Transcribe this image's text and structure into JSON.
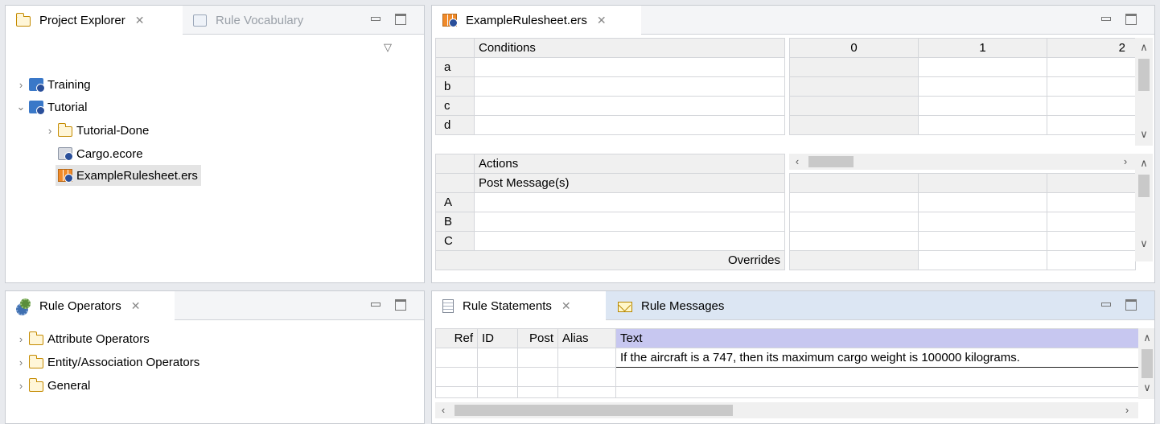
{
  "project_explorer": {
    "tabs": [
      {
        "label": "Project Explorer",
        "active": true
      },
      {
        "label": "Rule Vocabulary",
        "active": false
      }
    ],
    "view_menu_glyph": "▽",
    "tree": [
      {
        "label": "Training",
        "icon": "project-icon",
        "expanded": false,
        "level": 0
      },
      {
        "label": "Tutorial",
        "icon": "project-icon",
        "expanded": true,
        "level": 0
      },
      {
        "label": "Tutorial-Done",
        "icon": "folder-icon",
        "expanded": false,
        "level": 1
      },
      {
        "label": "Cargo.ecore",
        "icon": "ecore-file-icon",
        "level": 1
      },
      {
        "label": "ExampleRulesheet.ers",
        "icon": "rulesheet-file-icon",
        "level": 1,
        "selected": true
      }
    ]
  },
  "rule_operators": {
    "tab_label": "Rule Operators",
    "tree": [
      {
        "label": "Attribute Operators",
        "icon": "folder-icon"
      },
      {
        "label": "Entity/Association Operators",
        "icon": "folder-icon"
      },
      {
        "label": "General",
        "icon": "folder-icon"
      }
    ]
  },
  "rulesheet": {
    "tab_label": "ExampleRulesheet.ers",
    "conditions_header": "Conditions",
    "column_headers": [
      "0",
      "1",
      "2"
    ],
    "condition_rows": [
      "a",
      "b",
      "c",
      "d"
    ],
    "actions_header": "Actions",
    "post_messages_label": "Post Message(s)",
    "action_rows": [
      "A",
      "B",
      "C"
    ],
    "overrides_label": "Overrides"
  },
  "statements": {
    "tabs": [
      {
        "label": "Rule Statements",
        "active": true
      },
      {
        "label": "Rule Messages",
        "active": false
      }
    ],
    "columns": [
      "Ref",
      "ID",
      "Post",
      "Alias",
      "Text"
    ],
    "rows": [
      [
        "",
        "",
        "",
        "",
        "If the aircraft is a 747, then its maximum cargo weight is 100000 kilograms."
      ],
      [
        "",
        "",
        "",
        "",
        ""
      ],
      [
        "",
        "",
        "",
        "",
        ""
      ]
    ]
  },
  "colors": {
    "text_header_bg": "#c7c7f0",
    "selection_bg": "#e4e4e4",
    "tab_accent": "#5a8fd3"
  }
}
